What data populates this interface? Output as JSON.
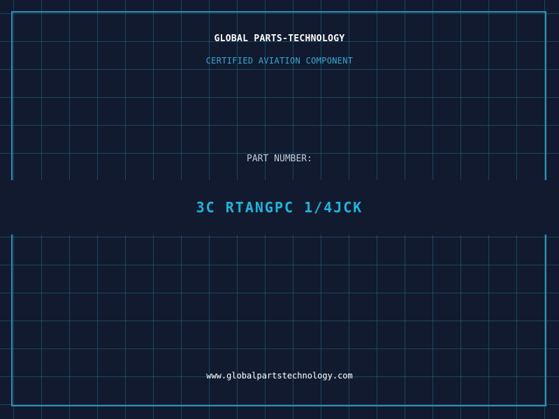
{
  "header": {
    "brand": "GLOBAL PARTS-TECHNOLOGY",
    "subtitle": "CERTIFIED AVIATION COMPONENT"
  },
  "part": {
    "label": "PART NUMBER:",
    "number": "3C RTANGPC 1/4JCK"
  },
  "footer": {
    "url": "www.globalpartstechnology.com"
  },
  "colors": {
    "background": "#111a2e",
    "grid": "#1e6e8c",
    "frame": "#2f8fb8",
    "accent": "#1fb6de",
    "subtitle": "#36a7d8",
    "label": "#c4ccd8",
    "text": "#ffffff"
  }
}
